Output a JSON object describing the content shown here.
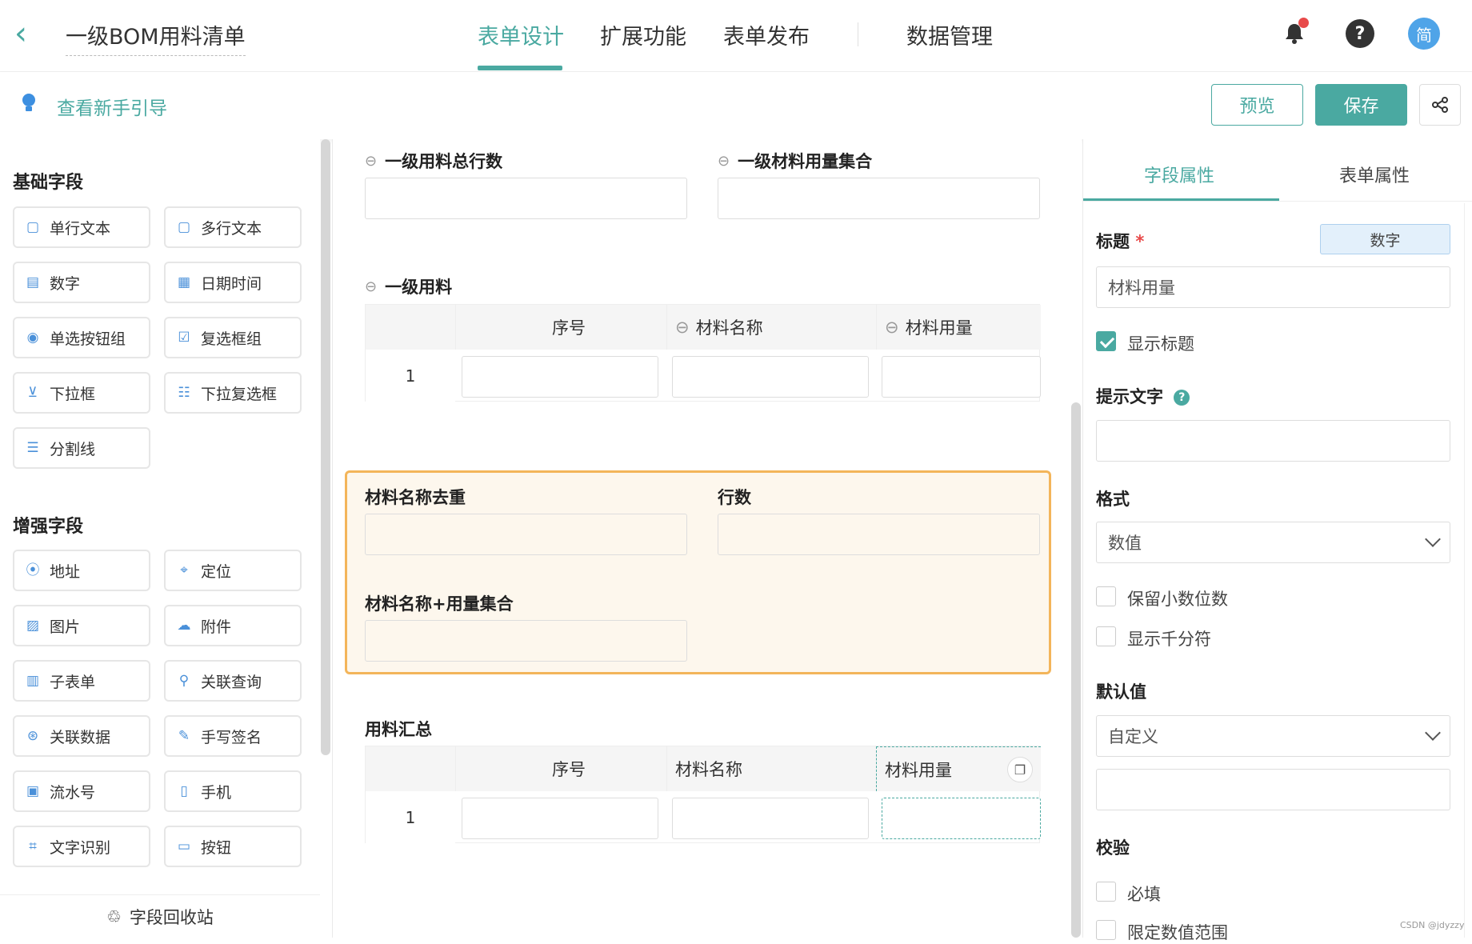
{
  "header": {
    "title": "一级BOM用料清单",
    "tabs": [
      {
        "label": "表单设计",
        "active": true
      },
      {
        "label": "扩展功能",
        "active": false
      },
      {
        "label": "表单发布",
        "active": false
      },
      {
        "label": "数据管理",
        "active": false
      }
    ],
    "avatar_text": "简"
  },
  "toolbar": {
    "guide_link": "查看新手引导",
    "preview_label": "预览",
    "save_label": "保存"
  },
  "palette": {
    "basic_title": "基础字段",
    "basic": [
      "单行文本",
      "多行文本",
      "数字",
      "日期时间",
      "单选按钮组",
      "复选框组",
      "下拉框",
      "下拉复选框",
      "分割线"
    ],
    "enhanced_title": "增强字段",
    "enhanced": [
      "地址",
      "定位",
      "图片",
      "附件",
      "子表单",
      "关联查询",
      "关联数据",
      "手写签名",
      "流水号",
      "手机",
      "文字识别",
      "按钮"
    ],
    "recycle_label": "字段回收站"
  },
  "canvas": {
    "field_total_rows": "一级用料总行数",
    "field_material_set": "一级材料用量集合",
    "subform1": {
      "title": "一级用料",
      "columns": [
        "序号",
        "材料名称",
        "材料用量"
      ],
      "row_index": "1"
    },
    "highlight": {
      "field_dedupe": "材料名称去重",
      "field_rows": "行数",
      "field_name_qty": "材料名称+用量集合"
    },
    "subform2": {
      "title": "用料汇总",
      "columns": [
        "序号",
        "材料名称",
        "材料用量"
      ],
      "row_index": "1"
    }
  },
  "properties": {
    "tabs": [
      {
        "label": "字段属性",
        "active": true
      },
      {
        "label": "表单属性",
        "active": false
      }
    ],
    "title_label": "标题",
    "required_mark": "*",
    "type_badge": "数字",
    "title_value": "材料用量",
    "show_title_label": "显示标题",
    "show_title_checked": true,
    "hint_label": "提示文字",
    "format_label": "格式",
    "format_value": "数值",
    "keep_decimals_label": "保留小数位数",
    "thousands_label": "显示千分符",
    "default_label": "默认值",
    "default_value": "自定义",
    "validate_label": "校验",
    "required_label": "必填",
    "range_label": "限定数值范围"
  },
  "watermark": "CSDN @jdyzzy",
  "colors": {
    "accent": "#4aa9a1",
    "highlight_border": "#f3b55a",
    "notify_dot": "#e84a4a",
    "avatar": "#4fa4e8"
  }
}
